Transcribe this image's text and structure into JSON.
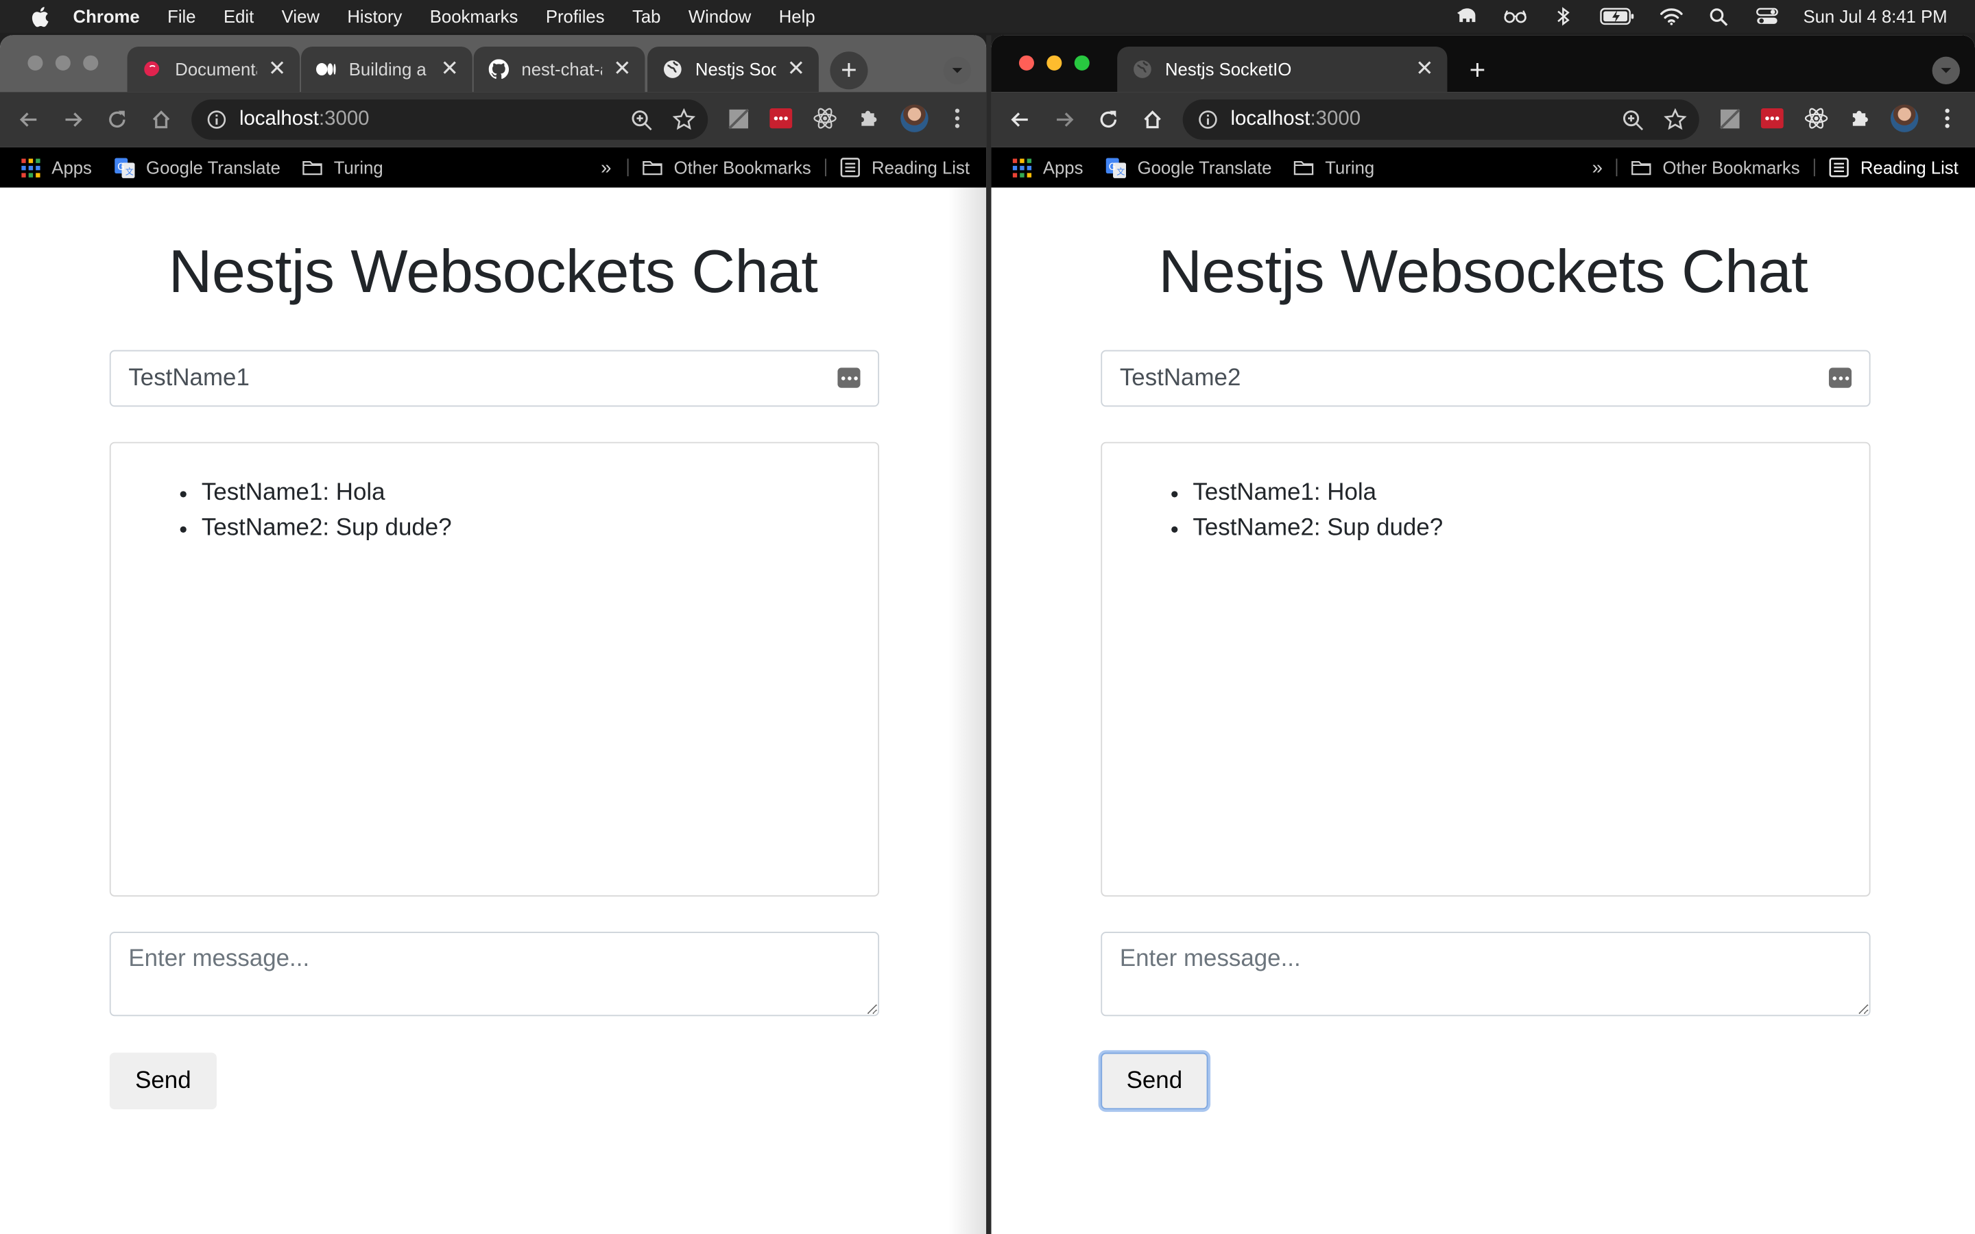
{
  "menubar": {
    "app_name": "Chrome",
    "items": [
      "File",
      "Edit",
      "View",
      "History",
      "Bookmarks",
      "Profiles",
      "Tab",
      "Window",
      "Help"
    ],
    "clock": "Sun Jul 4  8:41 PM",
    "status_icons": [
      "evernote-elephant-icon",
      "glasses-icon",
      "bluetooth-icon",
      "battery-charging-icon",
      "wifi-icon",
      "spotlight-search-icon",
      "control-center-icon"
    ]
  },
  "left_window": {
    "tabs": [
      {
        "title": "Documentation",
        "icon": "nestjs-logo-icon",
        "active": false
      },
      {
        "title": "Building a Real-Time Chat",
        "icon": "medium-logo-icon",
        "active": false
      },
      {
        "title": "nest-chat-app",
        "icon": "github-logo-icon",
        "active": false
      },
      {
        "title": "Nestjs SocketIO",
        "icon": "globe-icon",
        "active": true
      }
    ],
    "address": {
      "host": "localhost",
      "port": ":3000"
    },
    "bookmarks": {
      "apps": "Apps",
      "google_translate": "Google Translate",
      "turing": "Turing",
      "chevron": "»",
      "other": "Other Bookmarks",
      "reading_list": "Reading List"
    },
    "page": {
      "title": "Nestjs Websockets Chat",
      "name_value": "TestName1",
      "messages": [
        "TestName1: Hola",
        "TestName2: Sup dude?"
      ],
      "message_placeholder": "Enter message...",
      "send_label": "Send"
    }
  },
  "right_window": {
    "tabs": [
      {
        "title": "Nestjs SocketIO",
        "icon": "globe-icon",
        "active": true
      }
    ],
    "address": {
      "host": "localhost",
      "port": ":3000"
    },
    "bookmarks": {
      "apps": "Apps",
      "google_translate": "Google Translate",
      "turing": "Turing",
      "chevron": "»",
      "other": "Other Bookmarks",
      "reading_list": "Reading List"
    },
    "page": {
      "title": "Nestjs Websockets Chat",
      "name_value": "TestName2",
      "messages": [
        "TestName1: Hola",
        "TestName2: Sup dude?"
      ],
      "message_placeholder": "Enter message...",
      "send_label": "Send"
    }
  },
  "colors": {
    "brand_nest": "#e0234e",
    "page_text": "#212529",
    "menubar_bg": "#232323",
    "toolbar_bg": "#353535"
  }
}
